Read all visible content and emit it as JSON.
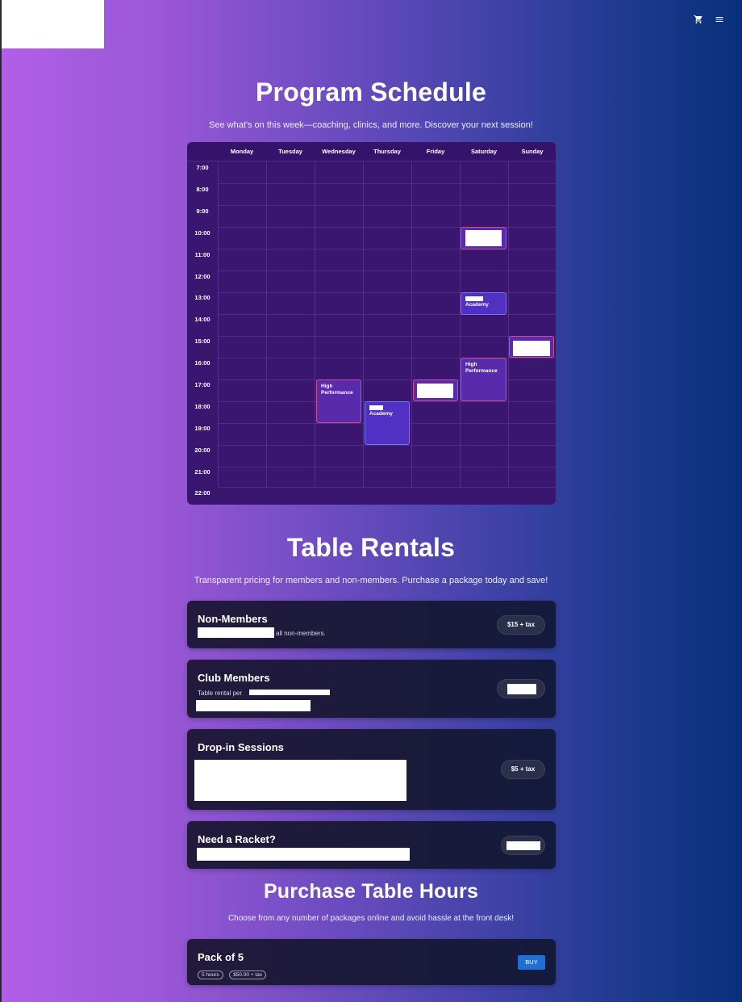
{
  "header": {
    "icons": [
      "cart-icon",
      "menu-icon"
    ]
  },
  "schedule": {
    "title": "Program Schedule",
    "subtitle": "See what's on this week—coaching, clinics, and more. Discover your next session!",
    "days": [
      "Monday",
      "Tuesday",
      "Wednesday",
      "Thursday",
      "Friday",
      "Saturday",
      "Sunday"
    ],
    "times": [
      "7:00",
      "8:00",
      "9:00",
      "10:00",
      "11:00",
      "12:00",
      "13:00",
      "14:00",
      "15:00",
      "16:00",
      "17:00",
      "18:00",
      "19:00",
      "20:00",
      "21:00",
      "22:00"
    ],
    "events": {
      "wed_hp": "High Performance",
      "thu_ac": "Academy",
      "sat_ac": "Academy",
      "sat_hp": "High Performance"
    }
  },
  "rentals": {
    "title": "Table Rentals",
    "subtitle": "Transparent pricing for members and non-members. Purchase a package today and save!",
    "cards": [
      {
        "title": "Non-Members",
        "desc": "all non-members.",
        "price": "$15 + tax"
      },
      {
        "title": "Club Members",
        "desc": "Table rental per",
        "price": ""
      },
      {
        "title": "Drop-in Sessions",
        "desc": "",
        "price": "$5 + tax"
      },
      {
        "title": "Need a Racket?",
        "desc": "",
        "price": ""
      }
    ]
  },
  "purchase": {
    "title": "Purchase Table Hours",
    "subtitle": "Choose from any number of packages online and avoid hassle at the front desk!",
    "packs": [
      {
        "title": "Pack of 5",
        "hours": "5 hours",
        "price": "$50.00 + tax",
        "button": "BUY"
      }
    ]
  },
  "colors": {
    "accent": "#1f6fd8",
    "high_performance": "#d0508a",
    "academy": "#6a7ce8"
  }
}
